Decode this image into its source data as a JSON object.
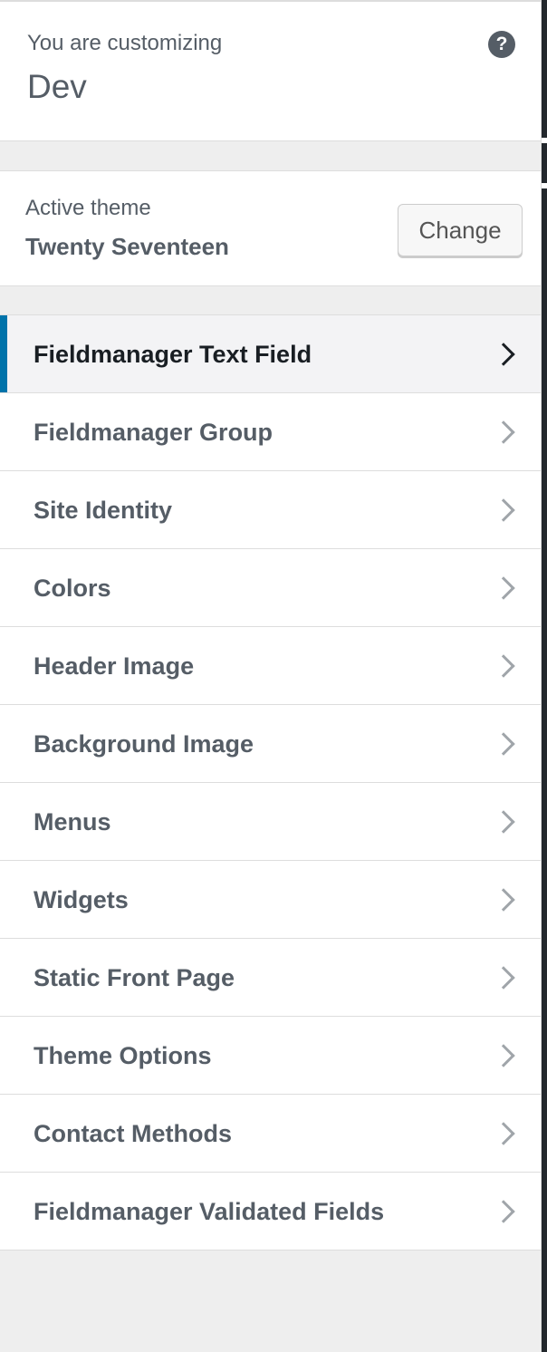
{
  "header": {
    "customizing_label": "You are customizing",
    "site_title": "Dev",
    "help_icon": "question-mark-icon",
    "help_glyph": "?"
  },
  "theme": {
    "active_label": "Active theme",
    "name": "Twenty Seventeen",
    "change_label": "Change"
  },
  "menu": {
    "items": [
      {
        "label": "Fieldmanager Text Field",
        "active": true
      },
      {
        "label": "Fieldmanager Group",
        "active": false
      },
      {
        "label": "Site Identity",
        "active": false
      },
      {
        "label": "Colors",
        "active": false
      },
      {
        "label": "Header Image",
        "active": false
      },
      {
        "label": "Background Image",
        "active": false
      },
      {
        "label": "Menus",
        "active": false
      },
      {
        "label": "Widgets",
        "active": false
      },
      {
        "label": "Static Front Page",
        "active": false
      },
      {
        "label": "Theme Options",
        "active": false
      },
      {
        "label": "Contact Methods",
        "active": false
      },
      {
        "label": "Fieldmanager Validated Fields",
        "active": false
      }
    ]
  },
  "colors": {
    "accent": "#0073aa",
    "text": "#555d66",
    "active_text": "#191e23",
    "background": "#eeeeee"
  }
}
